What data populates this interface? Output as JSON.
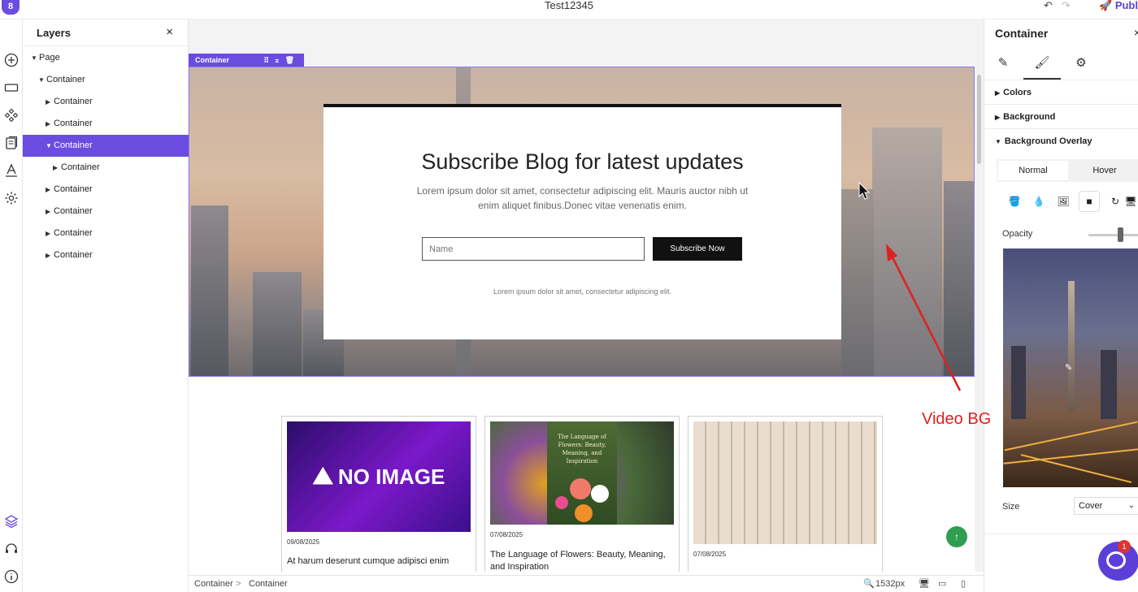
{
  "topbar": {
    "logo": "8",
    "title": "Test12345",
    "undo_icon": "undo-icon",
    "redo_icon": "redo-icon",
    "publish_label": "Publi"
  },
  "rail": {
    "icons": [
      "add-icon",
      "section-icon",
      "components-icon",
      "pages-icon",
      "typography-icon",
      "settings-gear-icon",
      "layers-icon",
      "support-headset-icon",
      "info-icon"
    ]
  },
  "layers": {
    "title": "Layers",
    "close": "×",
    "items": [
      {
        "label": "Page",
        "indent": 0,
        "expanded": true
      },
      {
        "label": "Container",
        "indent": 1,
        "expanded": true
      },
      {
        "label": "Container",
        "indent": 2,
        "expanded": false
      },
      {
        "label": "Container",
        "indent": 2,
        "expanded": false
      },
      {
        "label": "Container",
        "indent": 2,
        "expanded": true,
        "selected": true
      },
      {
        "label": "Container",
        "indent": 3,
        "expanded": false
      },
      {
        "label": "Container",
        "indent": 2,
        "expanded": false
      },
      {
        "label": "Container",
        "indent": 2,
        "expanded": false
      },
      {
        "label": "Container",
        "indent": 2,
        "expanded": false
      },
      {
        "label": "Container",
        "indent": 2,
        "expanded": false
      }
    ]
  },
  "canvas": {
    "selection_tag": "Container",
    "hero": {
      "title": "Subscribe Blog for latest updates",
      "description": "Lorem ipsum dolor sit amet, consectetur adipiscing elit. Mauris auctor nibh ut enim aliquet finibus.Donec vitae venenatis enim.",
      "input_placeholder": "Name",
      "button_label": "Subscribe Now",
      "footnote": "Lorem ipsum dolor sit amet, consectetur adipiscing elit."
    },
    "blog_cards": [
      {
        "image_text": "NO IMAGE",
        "date": "09/08/2025",
        "title": "At harum deserunt cumque adipisci enim"
      },
      {
        "image_text": "The Language of Flowers: Beauty, Meaning, and Inspiration",
        "date": "07/08/2025",
        "title": "The Language of Flowers: Beauty, Meaning, and Inspiration"
      },
      {
        "image_text": "",
        "date": "07/08/2025",
        "title": ""
      }
    ],
    "scroll_top_icon": "↑"
  },
  "bottombar": {
    "breadcrumb": [
      "Container",
      "Container"
    ],
    "separator": ">",
    "zoom": "1532px",
    "devices": [
      "desktop-icon",
      "tablet-icon",
      "mobile-icon"
    ]
  },
  "rpanel": {
    "title": "Container",
    "close": "×",
    "tabs": [
      "edit-pencil-icon",
      "style-brush-icon",
      "settings-gear-icon"
    ],
    "sections": [
      {
        "label": "Colors",
        "expanded": false
      },
      {
        "label": "Background",
        "expanded": false
      },
      {
        "label": "Background Overlay",
        "expanded": true
      }
    ],
    "state_tabs": {
      "normal": "Normal",
      "hover": "Hover"
    },
    "overlay_types": [
      "paint-bucket-icon",
      "drop-icon",
      "image-icon",
      "video-icon",
      "refresh-icon",
      "monitor-icon"
    ],
    "opacity_label": "Opacity",
    "opacity_value": 0.8,
    "size_label": "Size",
    "size_value": "Cover",
    "chat_badge": "1"
  },
  "annotation": {
    "label": "Video BG",
    "color": "#e02020"
  },
  "colors": {
    "accent": "#6a4ce0",
    "selection": "#8d7df2",
    "scroll_top": "#2f9e4f"
  }
}
